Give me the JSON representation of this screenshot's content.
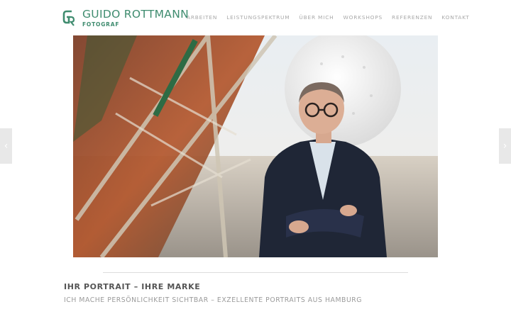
{
  "brand": {
    "name": "GUIDO ROTTMANN",
    "subtitle": "FOTOGRAF",
    "accent": "#3f8c6f"
  },
  "nav": {
    "items": [
      {
        "label": "ARBEITEN"
      },
      {
        "label": "LEISTUNGSPEKTRUM"
      },
      {
        "label": "ÜBER MICH"
      },
      {
        "label": "WORKSHOPS"
      },
      {
        "label": "REFERENZEN"
      },
      {
        "label": "KONTAKT"
      }
    ]
  },
  "slider": {
    "prev_icon": "‹",
    "next_icon": "›",
    "slide_count": 6,
    "active_slide": 2
  },
  "content": {
    "headline": "IHR PORTRAIT – IHRE MARKE",
    "subline": "ICH MACHE PERSÖNLICHKEIT SICHTBAR – EXZELLENTE PORTRAITS AUS HAMBURG"
  },
  "icons": {
    "logo": "gr-monogram-icon",
    "prev": "chevron-left-icon",
    "next": "chevron-right-icon"
  }
}
